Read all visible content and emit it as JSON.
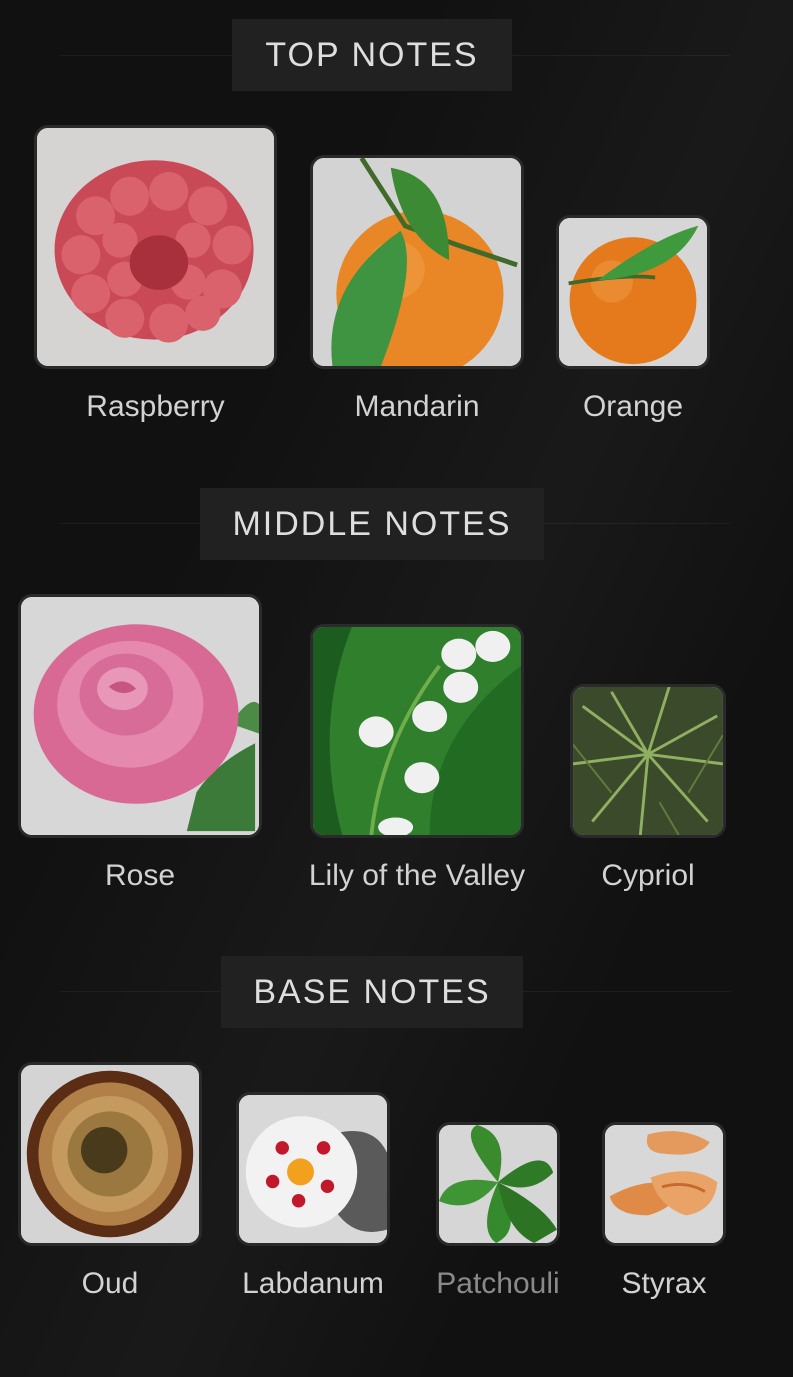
{
  "sections": [
    {
      "heading": "TOP NOTES",
      "notes": [
        {
          "label": "Raspberry",
          "icon": "raspberry-icon"
        },
        {
          "label": "Mandarin",
          "icon": "mandarin-icon"
        },
        {
          "label": "Orange",
          "icon": "orange-icon"
        }
      ]
    },
    {
      "heading": "MIDDLE NOTES",
      "notes": [
        {
          "label": "Rose",
          "icon": "rose-icon"
        },
        {
          "label": "Lily of the Valley",
          "icon": "lily-icon"
        },
        {
          "label": "Cypriol",
          "icon": "cypriol-icon"
        }
      ]
    },
    {
      "heading": "BASE NOTES",
      "notes": [
        {
          "label": "Oud",
          "icon": "oud-icon"
        },
        {
          "label": "Labdanum",
          "icon": "labdanum-icon"
        },
        {
          "label": "Patchouli",
          "icon": "patchouli-icon"
        },
        {
          "label": "Styrax",
          "icon": "styrax-icon"
        }
      ]
    }
  ],
  "colors": {
    "background": "#111111",
    "heading_bg": "#212121",
    "heading_text": "#dedede",
    "label_text": "#d2d2d2",
    "label_dim": "#8a8a8a"
  }
}
